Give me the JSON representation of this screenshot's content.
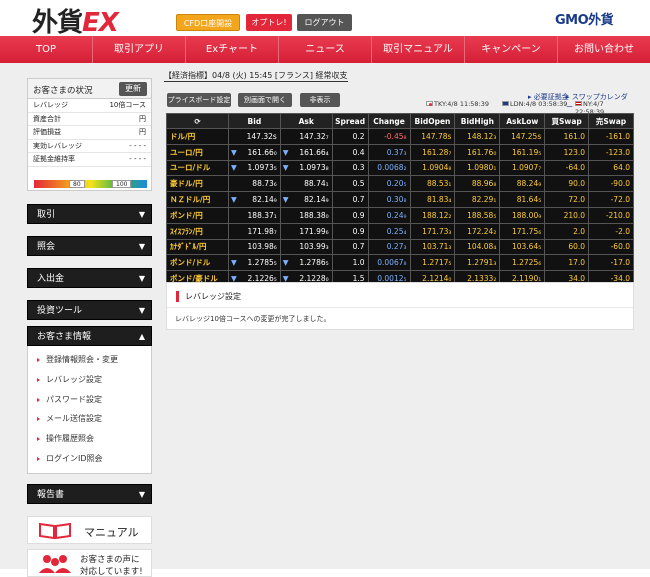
{
  "header": {
    "logo_main": "外貨",
    "logo_ex": "EX",
    "cfd_button": "CFD口座開設",
    "option_button": "オプトレ!",
    "logout_button": "ログアウト",
    "brand": "GMO外貨"
  },
  "nav": [
    "TOP",
    "取引アプリ",
    "Exチャート",
    "ニュース",
    "取引マニュアル",
    "キャンペーン",
    "お問い合わせ"
  ],
  "status": {
    "title": "お客さまの状況",
    "refresh": "更新",
    "rows": [
      {
        "label": "レバレッジ",
        "value": "10倍コース"
      },
      {
        "label": "資産合計",
        "value": "円"
      },
      {
        "label": "評価損益",
        "value": "円"
      },
      {
        "label": "実効レバレッジ",
        "value": "- - - -"
      },
      {
        "label": "証拠金維持率",
        "value": "- - - -"
      }
    ],
    "gauge_low": "80",
    "gauge_high": "100"
  },
  "menu": {
    "trade": "取引",
    "inquiry": "照会",
    "deposit": "入出金",
    "tools": "投資ツール",
    "info": "お客さま情報",
    "info_items": [
      "登録情報照会・変更",
      "レバレッジ設定",
      "パスワード設定",
      "メール送信設定",
      "操作履歴照会",
      "ログインID照会"
    ],
    "report": "報告書",
    "manual": "マニュアル",
    "voice_line1": "お客さまの声に",
    "voice_line2": "対応しています!"
  },
  "main": {
    "news": "【経済指標】04/8 (火) 15:45 [フランス] 経常収支",
    "board_button": "プライスボード設定",
    "separate_button": "別画面で開く",
    "hide_button": "非表示",
    "margin_link": "必要証拠金",
    "swap_link": "スワップカレンダー",
    "clock_tky": "TKY:4/8 11:58:39",
    "clock_ldn": "LDN:4/8 03:58:39",
    "clock_ny": "NY:4/7 22:58:39"
  },
  "rates": {
    "headers": [
      "",
      "Bid",
      "Ask",
      "Spread",
      "Change",
      "BidOpen",
      "BidHigh",
      "AskLow",
      "買Swap",
      "売Swap"
    ],
    "rows": [
      {
        "pair": "ドル/円",
        "bid": "147.32s",
        "ask": "147.32₇",
        "spread": "0.2",
        "change": "-0.45₈",
        "open": "147.78s",
        "high": "148.12₃",
        "low": "147.25s",
        "buy": "161.0",
        "sell": "-161.0",
        "down": false
      },
      {
        "pair": "ユーロ/円",
        "bid": "161.66₀",
        "ask": "161.66₄",
        "spread": "0.4",
        "change": "0.37₃",
        "open": "161.28₇",
        "high": "161.76₀",
        "low": "161.19₅",
        "buy": "123.0",
        "sell": "-123.0",
        "down": true
      },
      {
        "pair": "ユーロ/ドル",
        "bid": "1.0973₅",
        "ask": "1.0973₈",
        "spread": "0.3",
        "change": "0.0068₂",
        "open": "1.0904₈",
        "high": "1.0980₁",
        "low": "1.0907₇",
        "buy": "-64.0",
        "sell": "64.0",
        "down": true
      },
      {
        "pair": "豪ドル/円",
        "bid": "88.73₆",
        "ask": "88.74₁",
        "spread": "0.5",
        "change": "0.20₅",
        "open": "88.53₁",
        "high": "88.96₈",
        "low": "88.24₉",
        "buy": "90.0",
        "sell": "-90.0",
        "down": false
      },
      {
        "pair": "ＮＺドル/円",
        "bid": "82.14₉",
        "ask": "82.14₉",
        "spread": "0.7",
        "change": "0.30₈",
        "open": "81.83₄",
        "high": "82.29₁",
        "low": "81.64₅",
        "buy": "72.0",
        "sell": "-72.0",
        "down": true
      },
      {
        "pair": "ポンド/円",
        "bid": "188.37₁",
        "ask": "188.38₀",
        "spread": "0.9",
        "change": "0.24₉",
        "open": "188.12₂",
        "high": "188.58₅",
        "low": "188.00₉",
        "buy": "210.0",
        "sell": "-210.0",
        "down": false
      },
      {
        "pair": "ｽｲｽﾌﾗﾝ/円",
        "bid": "171.98₇",
        "ask": "171.99₆",
        "spread": "0.9",
        "change": "0.25₄",
        "open": "171.73₃",
        "high": "172.24₂",
        "low": "171.75₆",
        "buy": "2.0",
        "sell": "-2.0",
        "down": false
      },
      {
        "pair": "ｶﾅﾀﾞﾄﾞﾙ/円",
        "bid": "103.98₆",
        "ask": "103.99₃",
        "spread": "0.7",
        "change": "0.27₃",
        "open": "103.71₃",
        "high": "104.08₄",
        "low": "103.64₅",
        "buy": "60.0",
        "sell": "-60.0",
        "down": false
      },
      {
        "pair": "ポンド/ドル",
        "bid": "1.2785₅",
        "ask": "1.2786₅",
        "spread": "1.0",
        "change": "0.0067₈",
        "open": "1.2717₅",
        "high": "1.2791₃",
        "low": "1.2725₆",
        "buy": "17.0",
        "sell": "-17.0",
        "down": true
      },
      {
        "pair": "ポンド/豪ドル",
        "bid": "2.1226₅",
        "ask": "2.1228₀",
        "spread": "1.5",
        "change": "0.0012₅",
        "open": "2.1214₀",
        "high": "2.1333₂",
        "low": "2.1190₁",
        "buy": "34.0",
        "sell": "-34.0",
        "down": true
      }
    ]
  },
  "leverage": {
    "title": "レバレッジ設定",
    "message": "レバレッジ10倍コースへの変更が完了しました。"
  }
}
